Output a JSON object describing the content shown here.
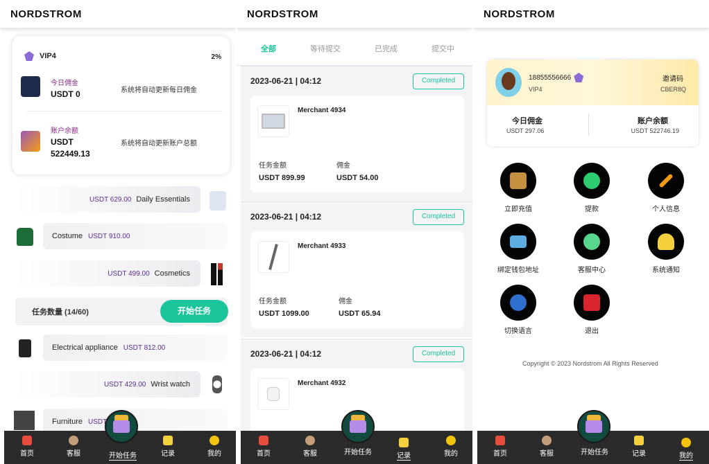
{
  "brand": "NORDSTROM",
  "home": {
    "vip_level": "VIP4",
    "vip_percent": "2%",
    "today_commission_label": "今日佣金",
    "today_commission_value": "USDT 0",
    "today_commission_note": "系统将自动更新每日佣金",
    "balance_label": "账户余额",
    "balance_value_1": "USDT",
    "balance_value_2": "522449.13",
    "balance_note": "系统将自动更新账户总额",
    "categories": [
      {
        "price": "USDT 629.00",
        "name": "Daily Essentials"
      },
      {
        "price": "USDT 910.00",
        "name": "Costume"
      },
      {
        "price": "USDT 499.00",
        "name": "Cosmetics"
      },
      {
        "price": "USDT 812.00",
        "name": "Electrical appliance"
      },
      {
        "price": "USDT 429.00",
        "name": "Wrist watch"
      },
      {
        "price": "USDT",
        "name": "Furniture"
      }
    ],
    "task_count": "任务数量 (14/60)",
    "start_button": "开始任务"
  },
  "tabbar": {
    "home": "首页",
    "service": "客服",
    "start": "开始任务",
    "records": "记录",
    "mine": "我的"
  },
  "records": {
    "tabs": [
      "全部",
      "等待提交",
      "已完成",
      "提交中"
    ],
    "amount_label": "任务金额",
    "commission_label": "佣金",
    "items": [
      {
        "date": "2023-06-21 | 04:12",
        "status": "Completed",
        "merchant": "Merchant 4934",
        "amount": "USDT 899.99",
        "commission": "USDT 54.00"
      },
      {
        "date": "2023-06-21 | 04:12",
        "status": "Completed",
        "merchant": "Merchant 4933",
        "amount": "USDT 1099.00",
        "commission": "USDT 65.94"
      },
      {
        "date": "2023-06-21 | 04:12",
        "status": "Completed",
        "merchant": "Merchant 4932",
        "amount": "",
        "commission": ""
      }
    ]
  },
  "profile": {
    "phone": "18855556666",
    "vip": "VIP4",
    "invite_label": "邀请码",
    "invite_code": "CBER8Q",
    "today_label": "今日佣金",
    "today_value": "USDT 297.06",
    "balance_label": "账户余额",
    "balance_value": "USDT 522746.19",
    "menu": [
      "立即充值",
      "提款",
      "个人信息",
      "绑定钱包地址",
      "客服中心",
      "系统通知",
      "切换语言",
      "退出"
    ],
    "copyright": "Copyright © 2023 Nordstrom All Rights Reserved"
  },
  "colors": {
    "accent": "#1bc49a",
    "price": "#5b2b8f",
    "tabbar": "#2b2b2b"
  }
}
